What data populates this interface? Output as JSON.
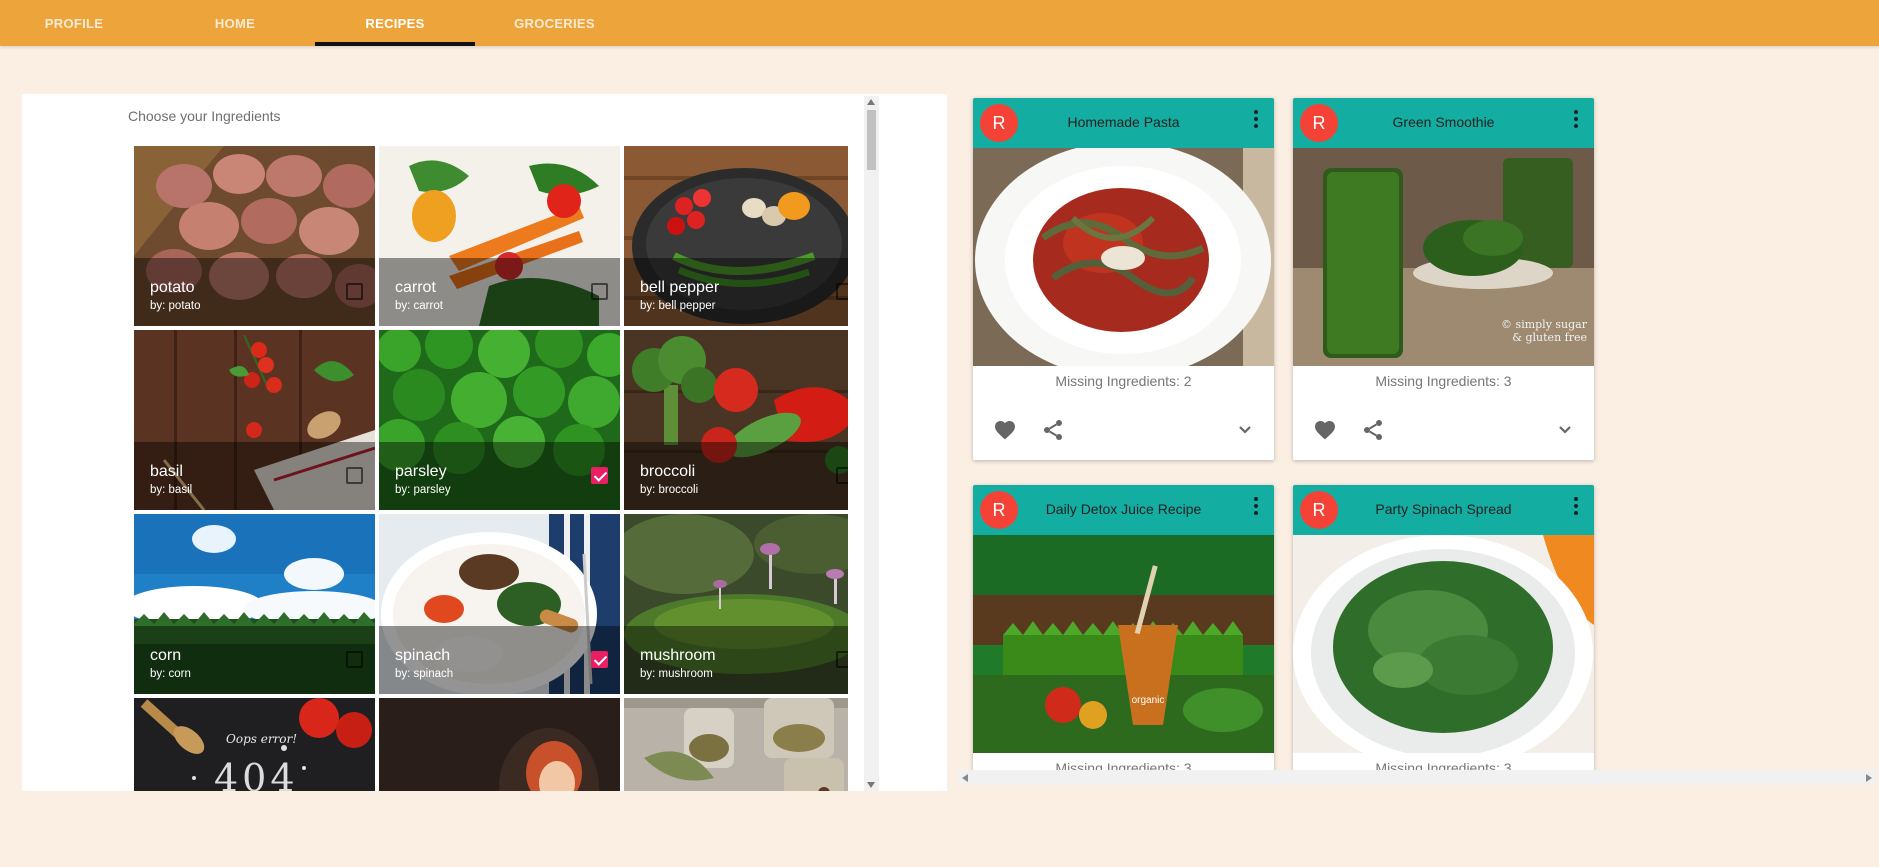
{
  "nav": {
    "tabs": [
      {
        "label": "PROFILE",
        "active": false
      },
      {
        "label": "HOME",
        "active": false
      },
      {
        "label": "RECIPES",
        "active": true
      },
      {
        "label": "GROCERIES",
        "active": false
      }
    ],
    "bar_color": "#eda53b",
    "indicator_color": "#111111"
  },
  "ingredients": {
    "title": "Choose your Ingredients",
    "items": [
      {
        "name": "potato",
        "by": "by: potato",
        "checked": false,
        "icon": "potato-photo"
      },
      {
        "name": "carrot",
        "by": "by: carrot",
        "checked": false,
        "icon": "carrot-photo"
      },
      {
        "name": "bell pepper",
        "by": "by: bell pepper",
        "checked": false,
        "icon": "bell-pepper-photo"
      },
      {
        "name": "basil",
        "by": "by: basil",
        "checked": false,
        "icon": "basil-photo"
      },
      {
        "name": "parsley",
        "by": "by: parsley",
        "checked": true,
        "icon": "parsley-photo"
      },
      {
        "name": "broccoli",
        "by": "by: broccoli",
        "checked": false,
        "icon": "broccoli-photo"
      },
      {
        "name": "corn",
        "by": "by: corn",
        "checked": false,
        "icon": "corn-photo"
      },
      {
        "name": "spinach",
        "by": "by: spinach",
        "checked": true,
        "icon": "spinach-photo"
      },
      {
        "name": "mushroom",
        "by": "by: mushroom",
        "checked": false,
        "icon": "mushroom-photo"
      }
    ],
    "error_tile_text": "Oops error!",
    "error_tile_code": "404",
    "check_color": "#e91e63"
  },
  "recipes": {
    "header_color": "#14ada1",
    "avatar_color": "#f44336",
    "cards": [
      {
        "avatar": "R",
        "title": "Homemade Pasta",
        "missing": "Missing Ingredients: 2"
      },
      {
        "avatar": "R",
        "title": "Green Smoothie",
        "missing": "Missing Ingredients: 3",
        "watermark": "© simply sugar & gluten free"
      },
      {
        "avatar": "R",
        "title": "Daily Detox Juice Recipe",
        "missing": "Missing Ingredients: 3",
        "cup_label": "organic"
      },
      {
        "avatar": "R",
        "title": "Party Spinach Spread",
        "missing": "Missing Ingredients: 3"
      }
    ]
  }
}
